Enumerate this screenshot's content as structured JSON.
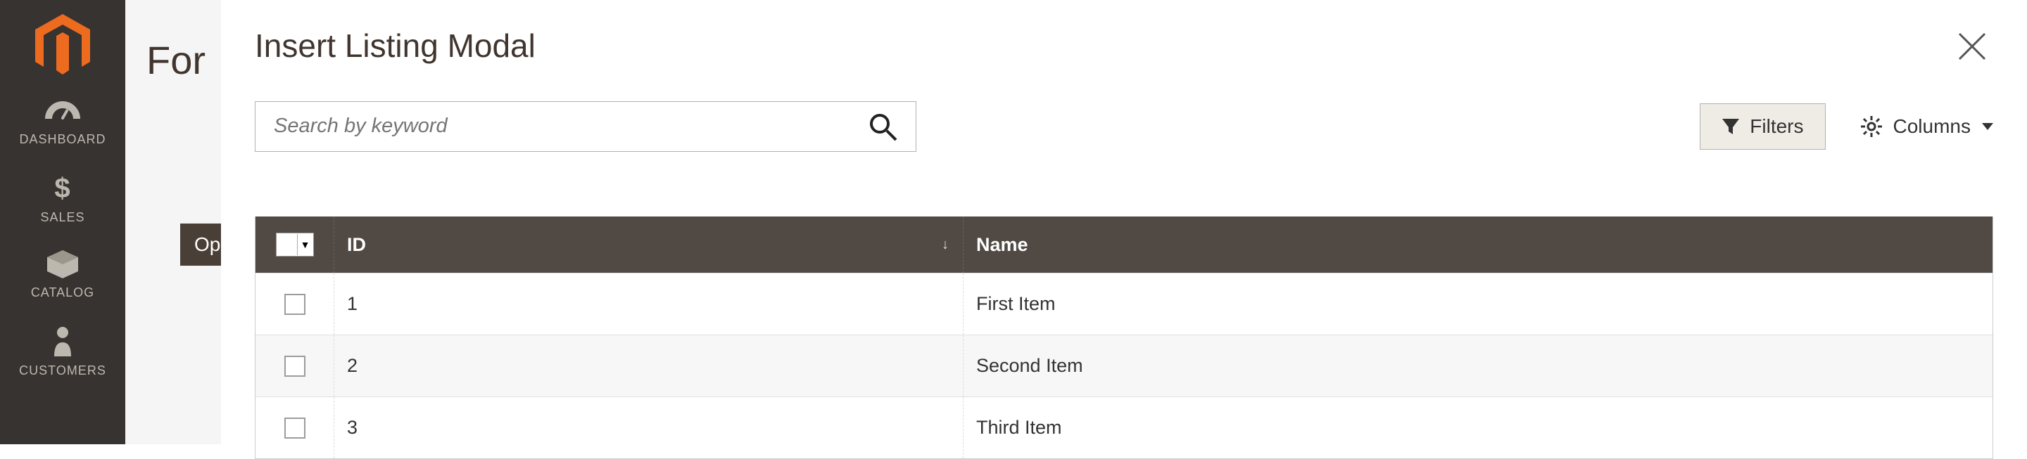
{
  "sidebar": {
    "items": [
      {
        "label": "DASHBOARD",
        "icon": "gauge-icon"
      },
      {
        "label": "SALES",
        "icon": "dollar-icon"
      },
      {
        "label": "CATALOG",
        "icon": "box-icon"
      },
      {
        "label": "CUSTOMERS",
        "icon": "person-icon"
      }
    ]
  },
  "page": {
    "title_partial": "For",
    "open_button_partial": "Op"
  },
  "modal": {
    "title": "Insert Listing Modal",
    "search_placeholder": "Search by keyword",
    "filters_label": "Filters",
    "columns_label": "Columns",
    "columns": {
      "id": "ID",
      "name": "Name"
    },
    "rows": [
      {
        "id": "1",
        "name": "First Item"
      },
      {
        "id": "2",
        "name": "Second Item"
      },
      {
        "id": "3",
        "name": "Third Item"
      }
    ]
  }
}
